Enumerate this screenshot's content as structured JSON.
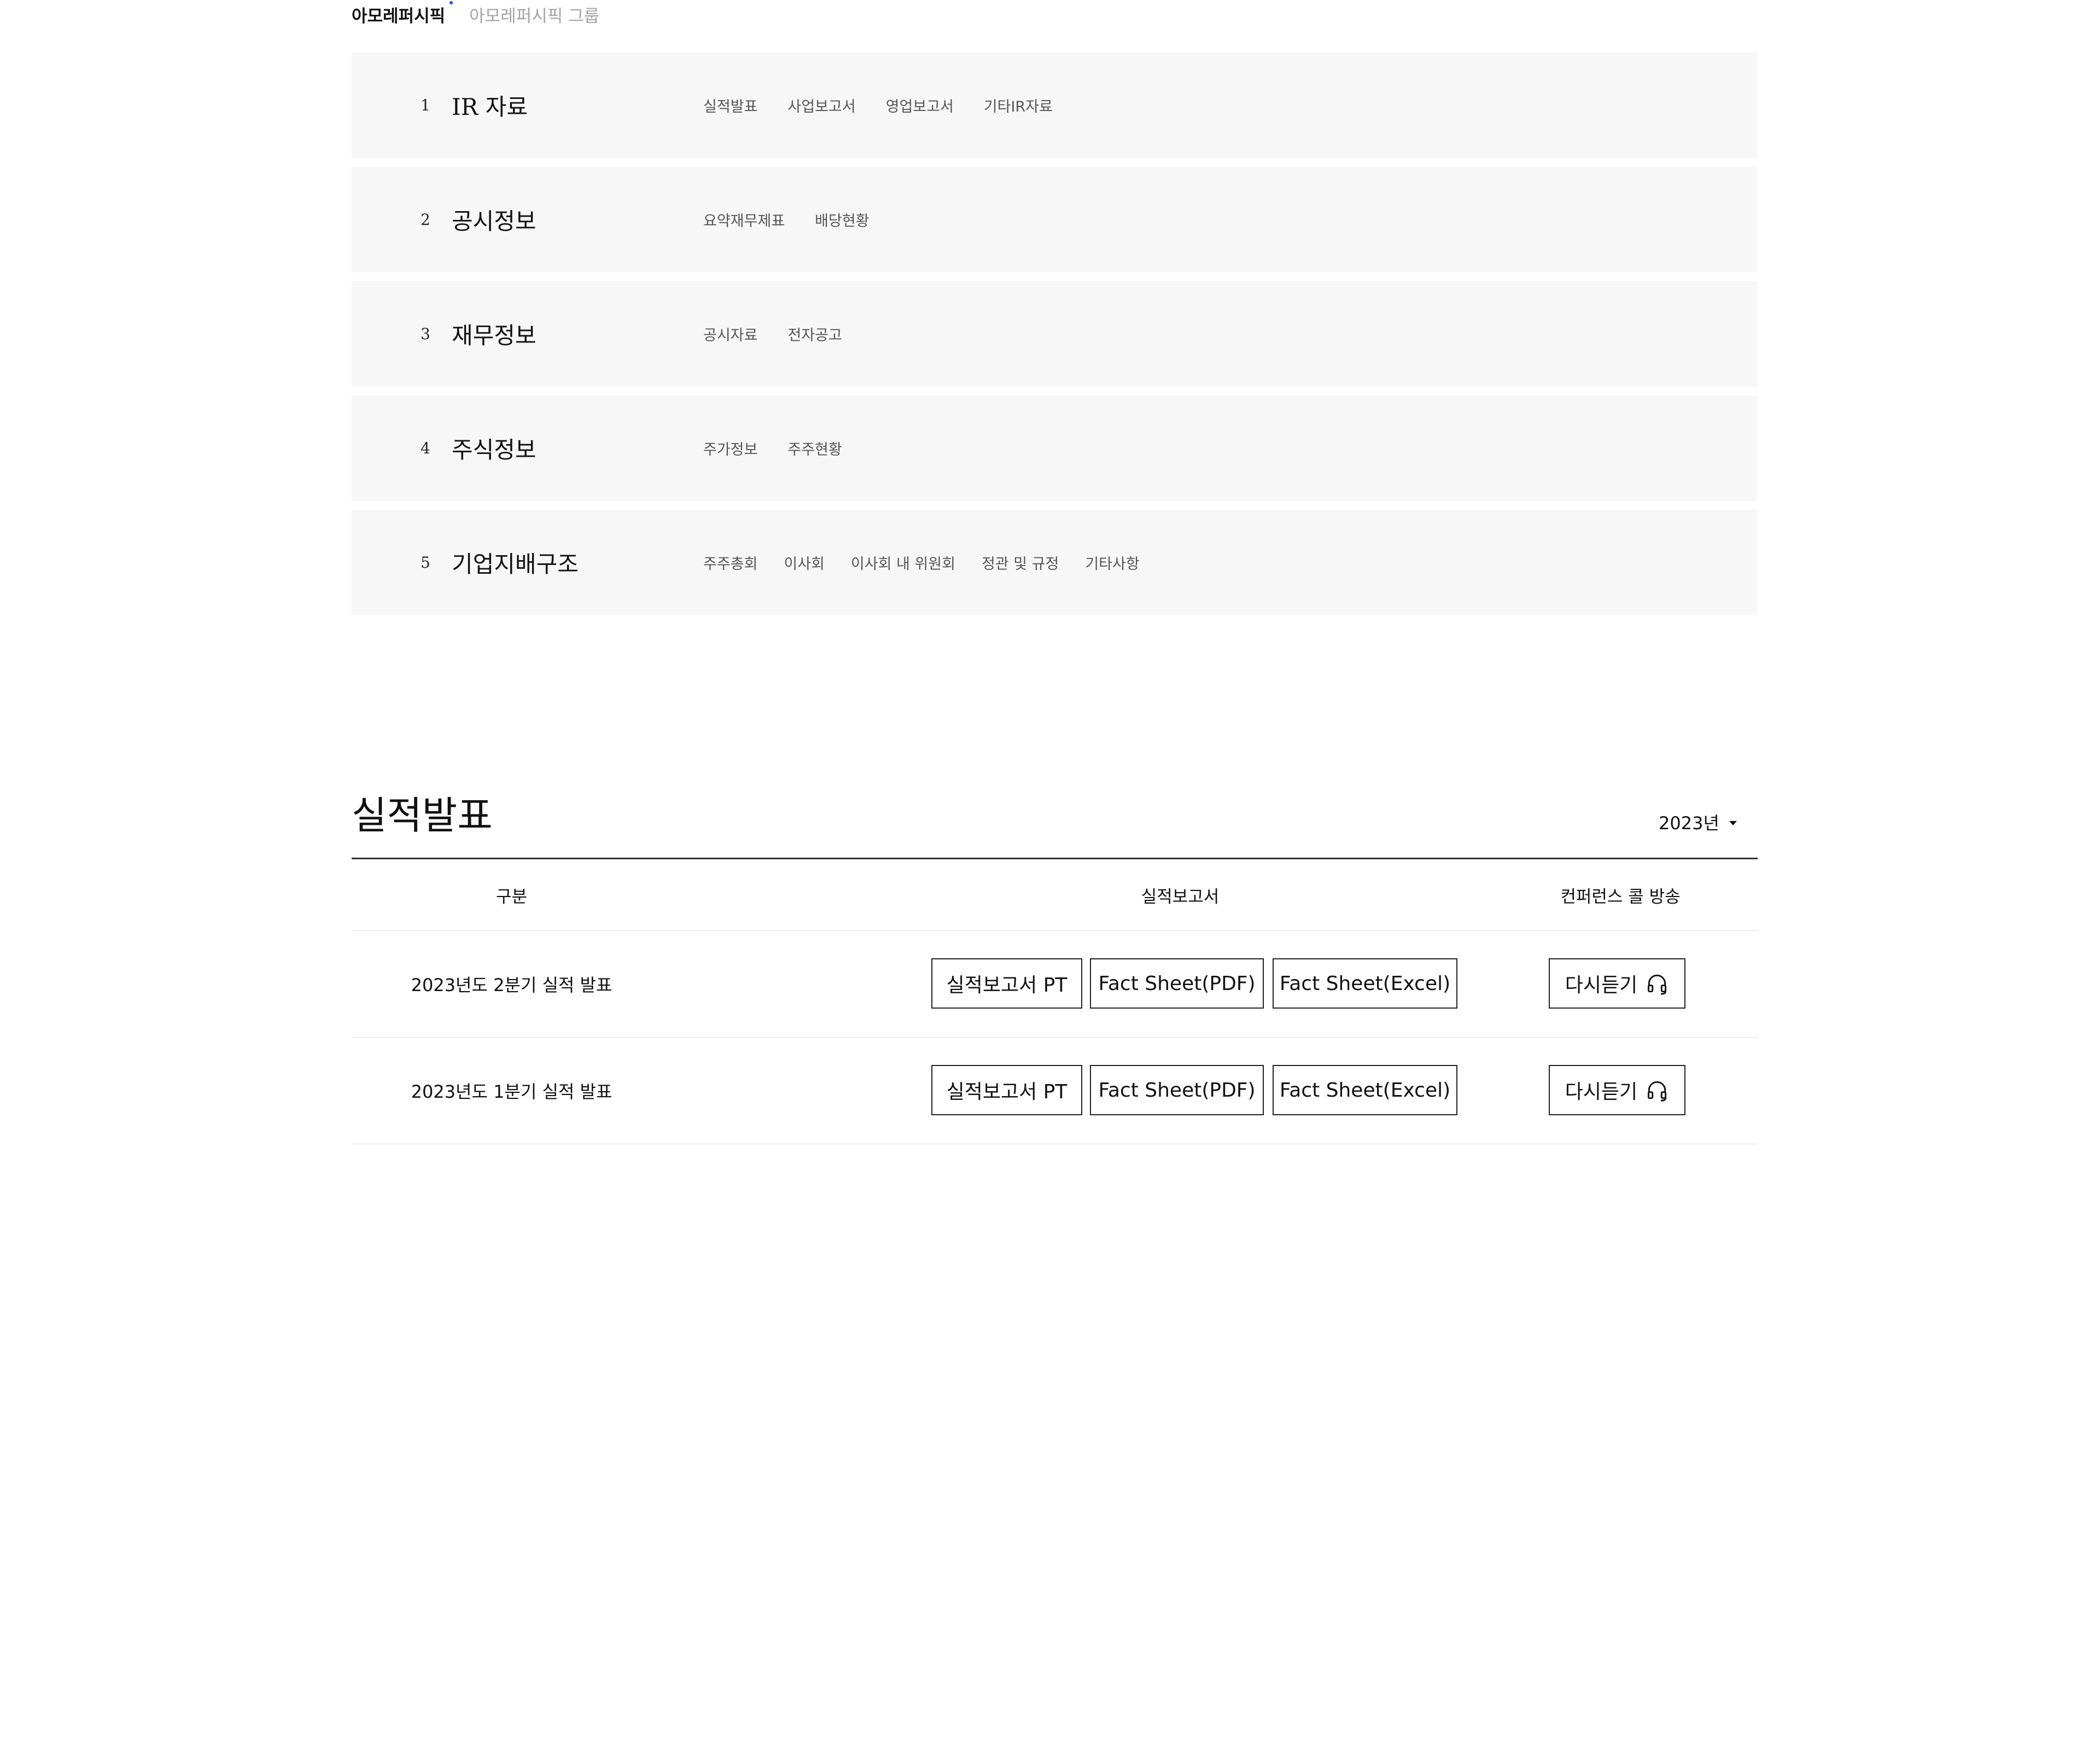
{
  "header": {
    "tabs": [
      {
        "label": "아모레퍼시픽",
        "active": true
      },
      {
        "label": "아모레퍼시픽 그룹",
        "active": false
      }
    ]
  },
  "ir_menu": {
    "rows": [
      {
        "number": "1",
        "title": "IR 자료",
        "links": [
          "실적발표",
          "사업보고서",
          "영업보고서",
          "기타IR자료"
        ]
      },
      {
        "number": "2",
        "title": "공시정보",
        "links": [
          "요약재무제표",
          "배당현황"
        ]
      },
      {
        "number": "3",
        "title": "재무정보",
        "links": [
          "공시자료",
          "전자공고"
        ]
      },
      {
        "number": "4",
        "title": "주식정보",
        "links": [
          "주가정보",
          "주주현황"
        ]
      },
      {
        "number": "5",
        "title": "기업지배구조",
        "links": [
          "주주총회",
          "이사회",
          "이사회 내 위원회",
          "정관 및 규정",
          "기타사항"
        ]
      }
    ]
  },
  "section": {
    "title": "실적발표",
    "year_select": "2023년"
  },
  "table": {
    "headers": [
      "구분",
      "실적보고서",
      "컨퍼런스 콜 방송"
    ],
    "rows": [
      {
        "label": "2023년도 2분기 실적 발표",
        "pt": "실적보고서 PT",
        "pdf": "Fact Sheet(PDF)",
        "excel": "Fact Sheet(Excel)",
        "listen": "다시듣기"
      },
      {
        "label": "2023년도 1분기 실적 발표",
        "pt": "실적보고서 PT",
        "pdf": "Fact Sheet(PDF)",
        "excel": "Fact Sheet(Excel)",
        "listen": "다시듣기"
      }
    ]
  },
  "icons": {
    "listen": "headphones-icon",
    "year": "caret-down-icon"
  },
  "colors": {
    "menu_bg": "#f7f7f7",
    "active_dot": "#1f55d6",
    "inactive_tab": "#a3a3a3"
  }
}
